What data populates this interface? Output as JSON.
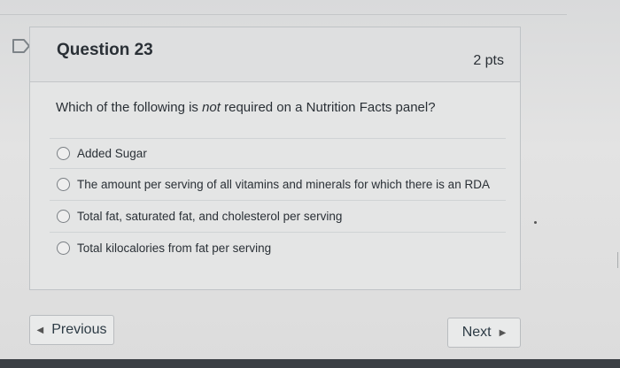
{
  "question": {
    "title": "Question 23",
    "points": "2 pts",
    "text_before": "Which of the following is ",
    "text_emphasis": "not",
    "text_after": " required on a Nutrition Facts panel?"
  },
  "answers": [
    {
      "label": "Added Sugar",
      "selected": false
    },
    {
      "label": "The amount per serving of all vitamins and minerals for which there is an RDA",
      "selected": false
    },
    {
      "label": "Total fat, saturated fat, and cholesterol per serving",
      "selected": false
    },
    {
      "label": "Total kilocalories from fat per serving",
      "selected": false
    }
  ],
  "nav": {
    "previous_label": "Previous",
    "next_label": "Next"
  },
  "colors": {
    "text": "#2a3036",
    "card_border": "#bfc3c6",
    "bottom_bar": "#3b3f44"
  },
  "icons": {
    "flag": "flag-icon",
    "previous": "triangle-left-icon",
    "next": "triangle-right-icon"
  }
}
